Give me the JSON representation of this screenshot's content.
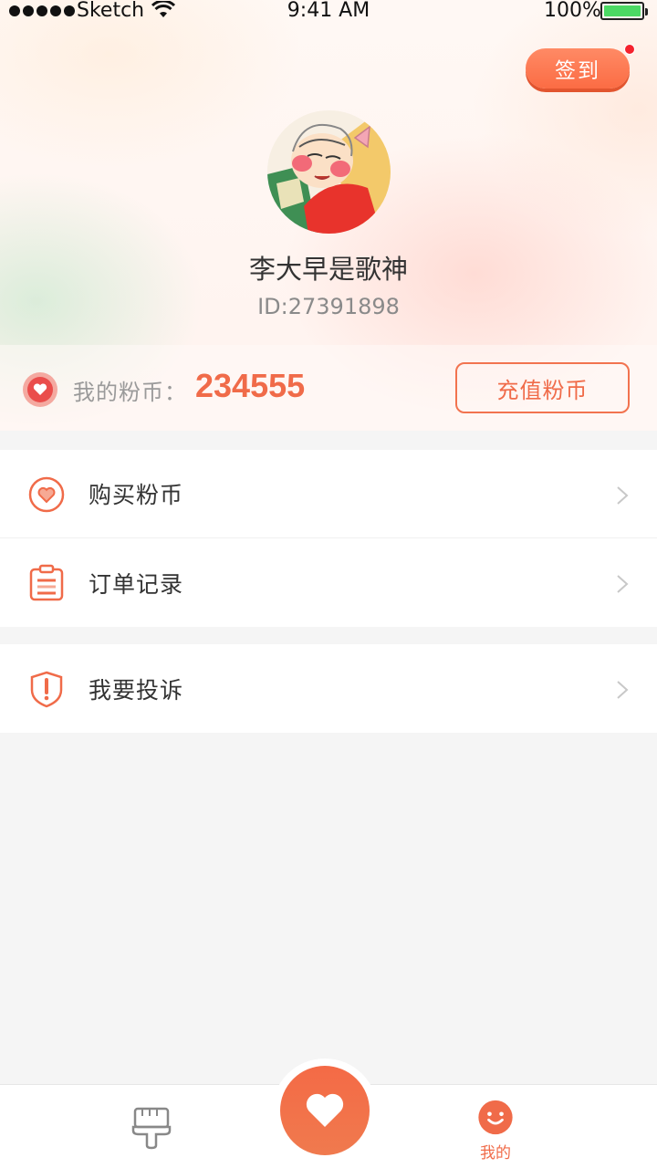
{
  "status_bar": {
    "carrier": "Sketch",
    "time": "9:41 AM",
    "battery": "100%"
  },
  "header": {
    "signin_label": "签到",
    "username": "李大早是歌神",
    "user_id": "ID:27391898"
  },
  "coins": {
    "label": "我的粉币：",
    "value": "234555",
    "recharge_label": "充值粉币"
  },
  "menu": {
    "group1": [
      {
        "label": "购买粉币",
        "icon": "heart-circle-icon"
      },
      {
        "label": "订单记录",
        "icon": "clipboard-icon"
      }
    ],
    "group2": [
      {
        "label": "我要投诉",
        "icon": "shield-alert-icon"
      }
    ]
  },
  "tab_bar": {
    "home_icon": "brush-icon",
    "center_icon": "heart-icon",
    "mine_label": "我的"
  },
  "colors": {
    "accent": "#f06b49",
    "background": "#f5f5f5"
  }
}
